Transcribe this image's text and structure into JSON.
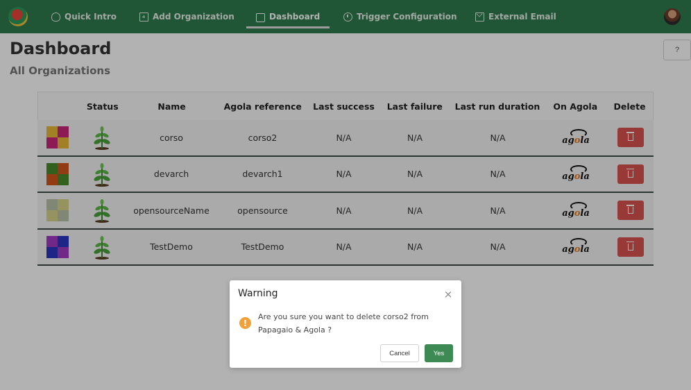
{
  "nav": {
    "items": [
      {
        "label": "Quick Intro",
        "icon": "lightbulb-icon"
      },
      {
        "label": "Add Organization",
        "icon": "plus-square-icon"
      },
      {
        "label": "Dashboard",
        "icon": "dashboard-icon",
        "active": true
      },
      {
        "label": "Trigger Configuration",
        "icon": "clock-icon"
      },
      {
        "label": "External Email",
        "icon": "mail-icon"
      }
    ]
  },
  "page": {
    "title": "Dashboard",
    "subtitle": "All Organizations",
    "help_label": "?"
  },
  "table": {
    "headers": [
      "",
      "Status",
      "Name",
      "Agola reference",
      "Last success",
      "Last failure",
      "Last run duration",
      "On Agola",
      "Delete"
    ],
    "rows": [
      {
        "avatar_colors": [
          "#c9287a",
          "#e8b83a"
        ],
        "name": "corso",
        "agola_ref": "corso2",
        "last_success": "N/A",
        "last_failure": "N/A",
        "last_run_duration": "N/A"
      },
      {
        "avatar_colors": [
          "#d0561c",
          "#4a8a2a"
        ],
        "name": "devarch",
        "agola_ref": "devarch1",
        "last_success": "N/A",
        "last_failure": "N/A",
        "last_run_duration": "N/A"
      },
      {
        "avatar_colors": [
          "#d6d48a",
          "#b8c2a8"
        ],
        "name": "opensourceName",
        "agola_ref": "opensource",
        "last_success": "N/A",
        "last_failure": "N/A",
        "last_run_duration": "N/A"
      },
      {
        "avatar_colors": [
          "#2a36c0",
          "#a23cc2"
        ],
        "name": "TestDemo",
        "agola_ref": "TestDemo",
        "last_success": "N/A",
        "last_failure": "N/A",
        "last_run_duration": "N/A"
      }
    ],
    "agola_logo_prefix": "ag",
    "agola_logo_o": "o",
    "agola_logo_suffix": "la"
  },
  "modal": {
    "title": "Warning",
    "close": "×",
    "warning_glyph": "!",
    "message": "Are you sure you want to delete corso2 from Papagaio & Agola ?",
    "cancel_label": "Cancel",
    "yes_label": "Yes"
  },
  "colors": {
    "nav_bg": "#2f7a4d",
    "delete_button": "#d9534f",
    "primary_button": "#3e8a55",
    "warning": "#f0a13a"
  }
}
